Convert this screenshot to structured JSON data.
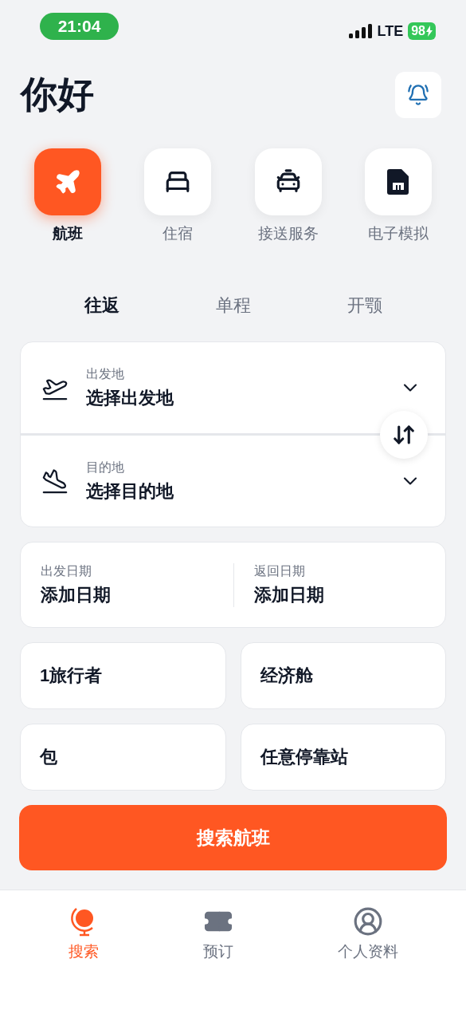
{
  "status_bar": {
    "time": "21:04",
    "network": "LTE",
    "battery": "98"
  },
  "greeting": "你好",
  "categories": [
    {
      "label": "航班",
      "selected": true
    },
    {
      "label": "住宿",
      "selected": false
    },
    {
      "label": "接送服务",
      "selected": false
    },
    {
      "label": "电子模拟",
      "selected": false
    }
  ],
  "trip_tabs": [
    {
      "label": "往返",
      "selected": true
    },
    {
      "label": "单程",
      "selected": false
    },
    {
      "label": "开颚",
      "selected": false
    }
  ],
  "locations": [
    {
      "label": "出发地",
      "value": "选择出发地"
    },
    {
      "label": "目的地",
      "value": "选择目的地"
    }
  ],
  "dates": [
    {
      "label": "出发日期",
      "value": "添加日期"
    },
    {
      "label": "返回日期",
      "value": "添加日期"
    }
  ],
  "options": [
    "1旅行者",
    "经济舱",
    "包",
    "任意停靠站"
  ],
  "search_button": "搜索航班",
  "bottom_nav": [
    {
      "label": "搜索",
      "selected": true
    },
    {
      "label": "预订",
      "selected": false
    },
    {
      "label": "个人资料",
      "selected": false
    }
  ]
}
